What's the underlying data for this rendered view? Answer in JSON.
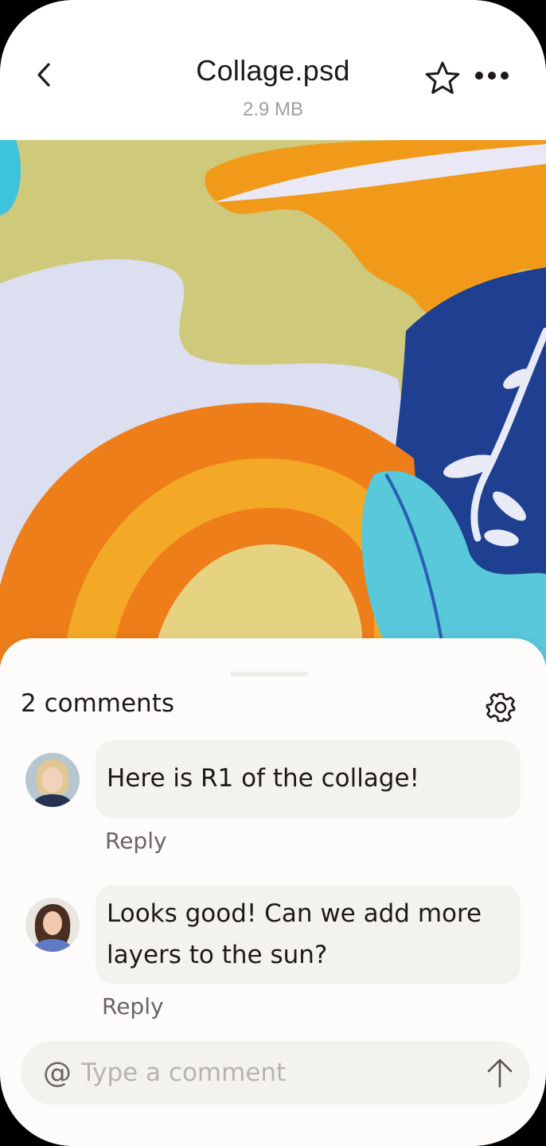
{
  "header": {
    "title": "Collage.psd",
    "file_size": "2.9 MB",
    "back_icon": "chevron-left-icon",
    "star_icon": "star-icon",
    "more_icon": "more-horizontal-icon"
  },
  "preview": {
    "image": "paper-collage-artwork"
  },
  "comments_panel": {
    "count_label": "2 comments",
    "settings_icon": "gear-icon",
    "comments": [
      {
        "text": "Here is R1 of the collage!",
        "reply_label": "Reply"
      },
      {
        "text": "Looks good! Can we add more layers to the sun?",
        "reply_label": "Reply"
      }
    ]
  },
  "composer": {
    "mention_symbol": "@",
    "placeholder": "Type a comment",
    "value": "",
    "send_icon": "arrow-up-icon"
  },
  "colors": {
    "text_primary": "#1e1919",
    "text_secondary": "#a19d9a",
    "bubble_bg": "#f4f2ef",
    "orange": "#ee7e1a",
    "navy": "#1f3f91",
    "cyan": "#53c9dc"
  }
}
